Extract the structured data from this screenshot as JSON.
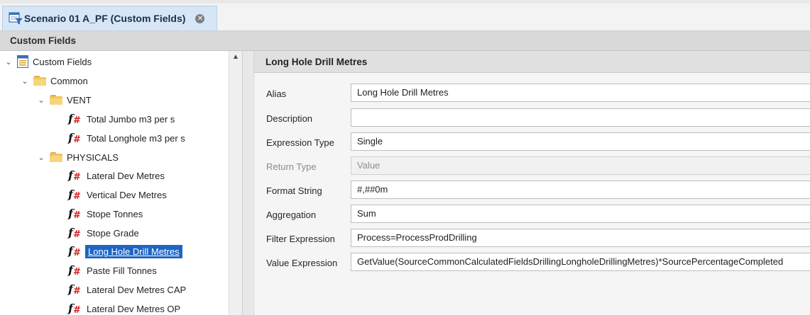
{
  "document_tab": {
    "title": "Scenario 01 A_PF (Custom Fields)",
    "icon": "scenario-filter-icon",
    "close_icon": "close-icon"
  },
  "section": {
    "title": "Custom Fields"
  },
  "tree": {
    "root": {
      "label": "Custom Fields",
      "icon": "custom-fields-icon"
    },
    "nodes": [
      {
        "label": "Common",
        "type": "folder"
      },
      {
        "label": "VENT",
        "type": "folder"
      },
      {
        "label": "Total Jumbo m3 per s",
        "type": "field"
      },
      {
        "label": "Total Longhole m3 per s",
        "type": "field"
      },
      {
        "label": "PHYSICALS",
        "type": "folder"
      },
      {
        "label": "Lateral Dev Metres",
        "type": "field"
      },
      {
        "label": "Vertical Dev Metres",
        "type": "field"
      },
      {
        "label": "Stope Tonnes",
        "type": "field"
      },
      {
        "label": "Stope Grade",
        "type": "field"
      },
      {
        "label": "Long Hole Drill Metres",
        "type": "field",
        "selected": true
      },
      {
        "label": "Paste Fill Tonnes",
        "type": "field"
      },
      {
        "label": "Lateral Dev Metres CAP",
        "type": "field"
      },
      {
        "label": "Lateral Dev Metres OP",
        "type": "field"
      }
    ]
  },
  "details": {
    "title": "Long Hole Drill Metres",
    "properties": [
      {
        "label": "Alias",
        "value": "Long Hole Drill Metres"
      },
      {
        "label": "Description",
        "value": ""
      },
      {
        "label": "Expression Type",
        "value": "Single"
      },
      {
        "label": "Return Type",
        "value": "Value",
        "disabled": true
      },
      {
        "label": "Format String",
        "value": "#,##0m"
      },
      {
        "label": "Aggregation",
        "value": "Sum"
      },
      {
        "label": "Filter Expression",
        "value": "Process=ProcessProdDrilling"
      },
      {
        "label": "Value Expression",
        "value": "GetValue(SourceCommonCalculatedFieldsDrillingLongholeDrillingMetres)*SourcePercentageCompleted"
      }
    ]
  },
  "colors": {
    "selection": "#1f66c4",
    "tab_active": "#d6e6f7",
    "fx_hash": "#d42020",
    "folder": "#f2c45c"
  }
}
